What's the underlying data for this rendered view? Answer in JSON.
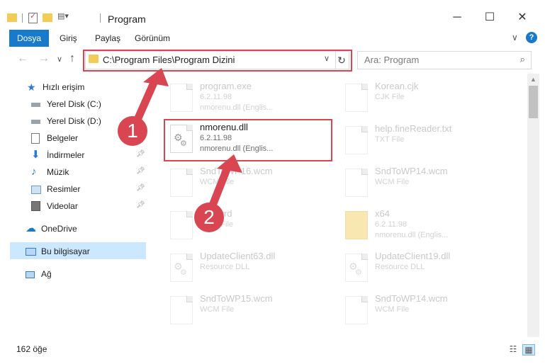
{
  "window": {
    "title": "Program",
    "minimize": "─",
    "maximize": "☐",
    "close": "✕"
  },
  "ribbon": {
    "tabs": [
      "Dosya",
      "Giriş",
      "Paylaş",
      "Görünüm"
    ],
    "collapse": "∨",
    "help": "?"
  },
  "address": {
    "path": "C:\\Program Files\\Program Dizini",
    "dropdown": "∨",
    "refresh": "↻"
  },
  "search": {
    "placeholder": "Ara: Program",
    "icon": "⌕"
  },
  "nav": {
    "back": "←",
    "forward": "→",
    "recent": "∨",
    "up": "↑",
    "items": [
      {
        "label": "Hızlı erişim",
        "icon": "star-icon",
        "pinned": false
      },
      {
        "label": "Yerel Disk (C:)",
        "icon": "drive-icon",
        "pinned": false
      },
      {
        "label": "Yerel Disk (D:)",
        "icon": "drive-icon",
        "pinned": false
      },
      {
        "label": "Belgeler",
        "icon": "documents-icon",
        "pinned": false
      },
      {
        "label": "İndirmeler",
        "icon": "download-icon",
        "pinned": true
      },
      {
        "label": "Müzik",
        "icon": "music-icon",
        "pinned": true
      },
      {
        "label": "Resimler",
        "icon": "pictures-icon",
        "pinned": true
      },
      {
        "label": "Videolar",
        "icon": "videos-icon",
        "pinned": true
      },
      {
        "label": "OneDrive",
        "icon": "cloud-icon",
        "pinned": false
      },
      {
        "label": "Bu bilgisayar",
        "icon": "computer-icon",
        "pinned": false
      },
      {
        "label": "Ağ",
        "icon": "network-icon",
        "pinned": false
      }
    ]
  },
  "files": {
    "left": [
      {
        "name": "program.exe",
        "line1": "6.2.11.98",
        "line2": "nmorenu.dll (Englis...",
        "icon": "exe-icon"
      },
      {
        "name": "nmorenu.dll",
        "line1": "6.2.11.98",
        "line2": "nmorenu.dll (Englis...",
        "icon": "dll-gear-icon",
        "highlighted": true
      },
      {
        "name": "SndToWP16.wcm",
        "line1": "WCM File",
        "line2": "",
        "icon": "file-icon"
      },
      {
        "name": "sbd.wrd",
        "line1": "WRD File",
        "line2": "",
        "icon": "file-icon"
      },
      {
        "name": "UpdateClient63.dll",
        "line1": "Resource DLL",
        "line2": "",
        "icon": "dll-gear-icon"
      },
      {
        "name": "SndToWP15.wcm",
        "line1": "WCM File",
        "line2": "",
        "icon": "file-icon"
      }
    ],
    "right": [
      {
        "name": "Korean.cjk",
        "line1": "CJK File",
        "line2": "",
        "icon": "file-icon"
      },
      {
        "name": "help.fineReader.txt",
        "line1": "TXT File",
        "line2": "",
        "icon": "text-file-icon"
      },
      {
        "name": "SndToWP14.wcm",
        "line1": "WCM File",
        "line2": "",
        "icon": "file-icon"
      },
      {
        "name": "x64",
        "line1": "6.2.11.98",
        "line2": "nmorenu.dll (Englis...",
        "icon": "folder-icon"
      },
      {
        "name": "UpdateClient19.dll",
        "line1": "Resource DLL",
        "line2": "",
        "icon": "dll-gear-icon"
      },
      {
        "name": "SndToWP14.wcm",
        "line1": "WCM File",
        "line2": "",
        "icon": "file-icon"
      }
    ]
  },
  "status": {
    "count": "162 öğe",
    "details_view": "☷",
    "tiles_view": "▦"
  },
  "annotations": {
    "step1": "1",
    "step2": "2"
  },
  "colors": {
    "accent": "#1979ca",
    "highlight_box": "#d94550",
    "selected_nav": "#cce8ff"
  }
}
